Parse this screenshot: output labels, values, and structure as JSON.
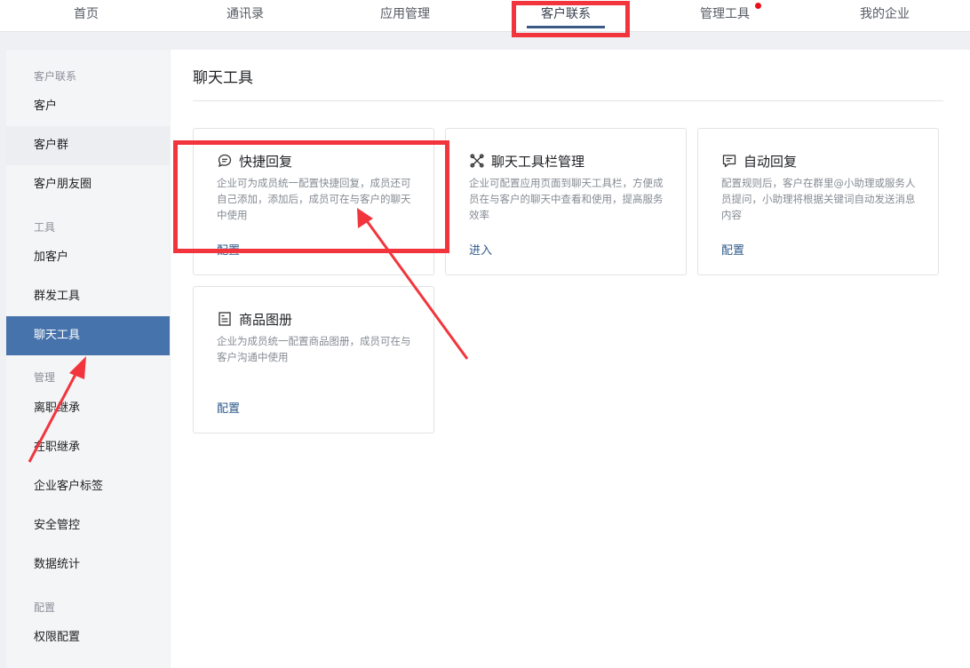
{
  "topnav": {
    "tabs": [
      {
        "label": "首页"
      },
      {
        "label": "通讯录"
      },
      {
        "label": "应用管理"
      },
      {
        "label": "客户联系"
      },
      {
        "label": "管理工具"
      },
      {
        "label": "我的企业"
      }
    ],
    "active_index": 3,
    "badge_on_tab": "管理工具"
  },
  "sidebar": {
    "groups": {
      "customer_contact": "客户联系",
      "tools": "工具",
      "management": "管理",
      "config": "配置"
    },
    "items": {
      "customer": "客户",
      "customer_group": "客户群",
      "moments": "客户朋友圈",
      "add_customer": "加客户",
      "mass_send": "群发工具",
      "chat_tools": "聊天工具",
      "resign_inherit": "离职继承",
      "onjob_inherit": "在职继承",
      "customer_tags": "企业客户标签",
      "security": "安全管控",
      "statistics": "数据统计",
      "permissions": "权限配置"
    },
    "active_item": "聊天工具"
  },
  "main": {
    "title": "聊天工具",
    "cards": [
      {
        "name": "快捷回复",
        "icon": "chat-bubble-icon",
        "desc": "企业可为成员统一配置快捷回复，成员还可自己添加，添加后，成员可在与客户的聊天中使用",
        "link": "配置"
      },
      {
        "name": "聊天工具栏管理",
        "icon": "toolbar-icon",
        "desc": "企业可配置应用页面到聊天工具栏，方便成员在与客户的聊天中查看和使用，提高服务效率",
        "link": "进入"
      },
      {
        "name": "自动回复",
        "icon": "auto-reply-icon",
        "desc": "配置规则后，客户在群里@小助理或服务人员提问，小助理将根据关键词自动发送消息内容",
        "link": "配置"
      },
      {
        "name": "商品图册",
        "icon": "product-album-icon",
        "desc": "企业为成员统一配置商品图册，成员可在与客户沟通中使用",
        "link": "配置"
      }
    ]
  },
  "colors": {
    "accent": "#4773ac",
    "link": "#2f5a8a",
    "highlight": "#f2353d",
    "badge": "#e8101a"
  }
}
